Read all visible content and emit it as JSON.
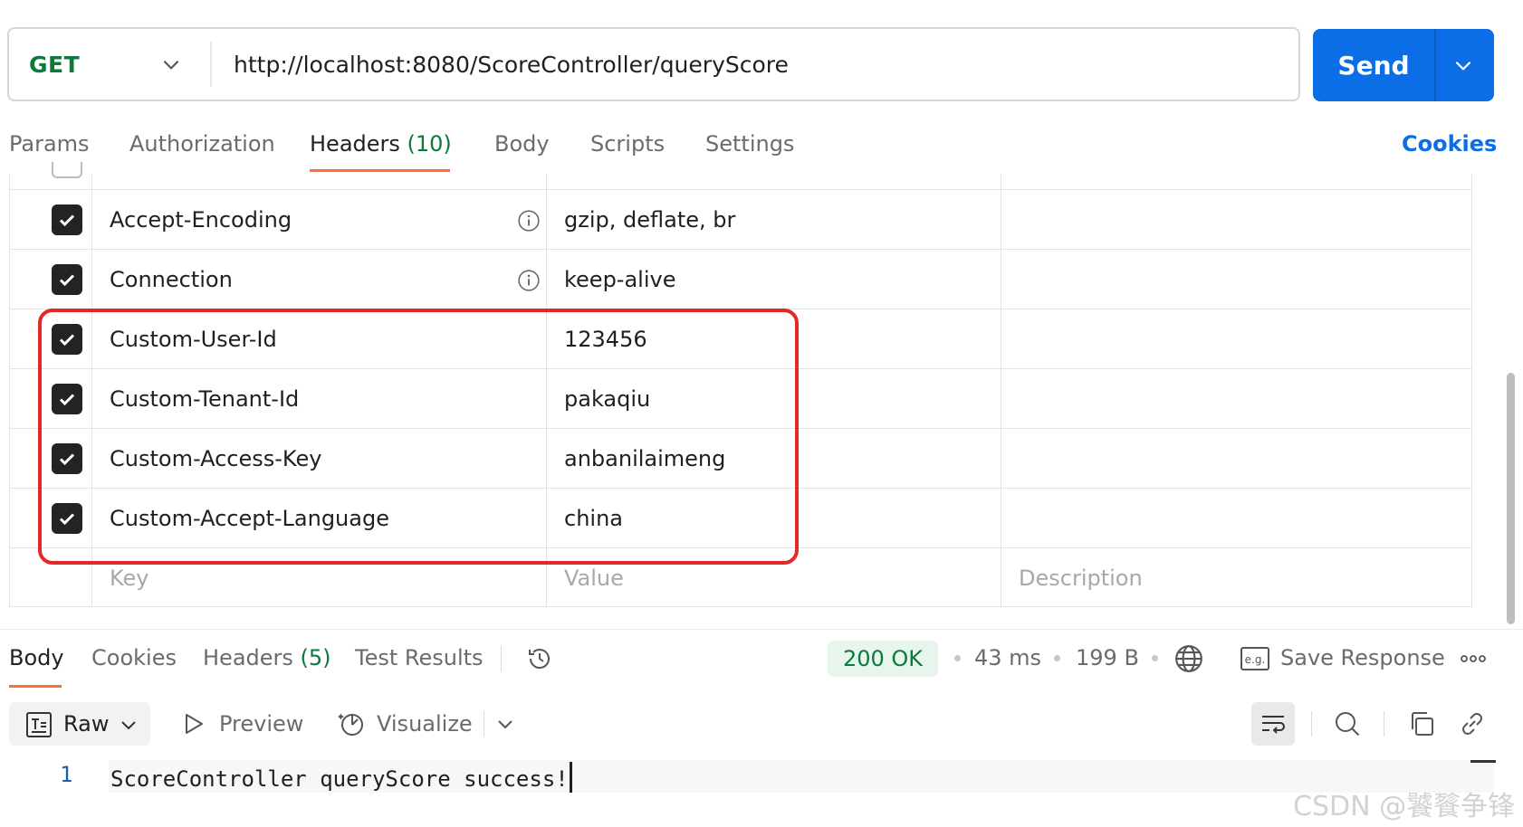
{
  "request": {
    "method": "GET",
    "url": "http://localhost:8080/ScoreController/queryScore",
    "send_label": "Send"
  },
  "request_tabs": {
    "params": "Params",
    "authorization": "Authorization",
    "headers": "Headers",
    "headers_count": "(10)",
    "body": "Body",
    "scripts": "Scripts",
    "settings": "Settings",
    "cookies": "Cookies"
  },
  "headers_table": {
    "rows": [
      {
        "key": "Accept-Encoding",
        "value": "gzip, deflate, br",
        "checked": true,
        "info": true
      },
      {
        "key": "Connection",
        "value": "keep-alive",
        "checked": true,
        "info": true
      },
      {
        "key": "Custom-User-Id",
        "value": "123456",
        "checked": true,
        "info": false
      },
      {
        "key": "Custom-Tenant-Id",
        "value": "pakaqiu",
        "checked": true,
        "info": false
      },
      {
        "key": "Custom-Access-Key",
        "value": "anbanilaimeng",
        "checked": true,
        "info": false
      },
      {
        "key": "Custom-Accept-Language",
        "value": "china",
        "checked": true,
        "info": false
      }
    ],
    "placeholders": {
      "key": "Key",
      "value": "Value",
      "description": "Description"
    }
  },
  "response_tabs": {
    "body": "Body",
    "cookies": "Cookies",
    "headers": "Headers",
    "headers_count": "(5)",
    "test_results": "Test Results"
  },
  "response_meta": {
    "status": "200 OK",
    "time": "43 ms",
    "size": "199 B",
    "save_response": "Save Response",
    "eg_badge": "e.g."
  },
  "response_toolbar": {
    "format": "Raw",
    "preview": "Preview",
    "visualize": "Visualize"
  },
  "response_body": {
    "lines": [
      {
        "number": "1",
        "text": "ScoreController queryScore success!"
      }
    ]
  },
  "watermark": "CSDN @饕餮争锋",
  "colors": {
    "send_button": "#0b6ee6",
    "method_green": "#0a7a3a",
    "active_tab_underline": "#ff6c37",
    "highlight_box": "#e32828",
    "link_blue": "#0b6ee6"
  },
  "icons": [
    "chevron-down-icon",
    "info-icon",
    "checkbox-checked-icon",
    "history-icon",
    "globe-icon",
    "eg-icon",
    "more-icon",
    "raw-format-icon",
    "preview-play-icon",
    "visualize-icon",
    "wrap-lines-icon",
    "search-icon",
    "copy-icon",
    "link-icon"
  ]
}
